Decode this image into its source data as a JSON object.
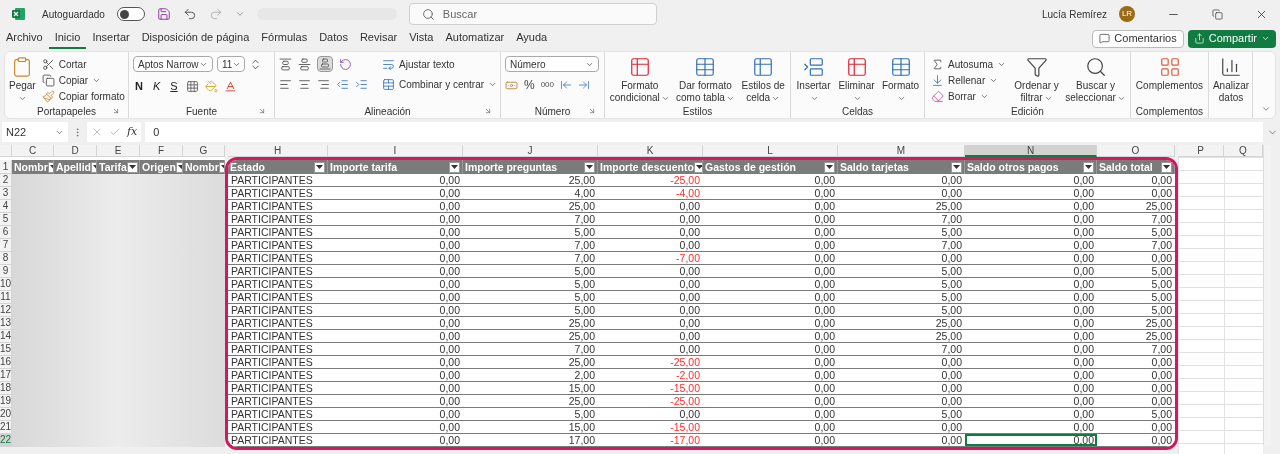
{
  "title_bar": {
    "autosave_label": "Autoguardado",
    "autosave_on": false,
    "search_placeholder": "Buscar",
    "user_name": "Lucía Remírez",
    "user_initials": "LR"
  },
  "menu_tabs": [
    {
      "label": "Archivo",
      "selected": false
    },
    {
      "label": "Inicio",
      "selected": true
    },
    {
      "label": "Insertar",
      "selected": false
    },
    {
      "label": "Disposición de página",
      "selected": false
    },
    {
      "label": "Fórmulas",
      "selected": false
    },
    {
      "label": "Datos",
      "selected": false
    },
    {
      "label": "Revisar",
      "selected": false
    },
    {
      "label": "Vista",
      "selected": false
    },
    {
      "label": "Automatizar",
      "selected": false
    },
    {
      "label": "Ayuda",
      "selected": false
    }
  ],
  "actions": {
    "comments": "Comentarios",
    "share": "Compartir"
  },
  "ribbon": {
    "clipboard": {
      "title": "Portapapeles",
      "paste": "Pegar",
      "cut": "Cortar",
      "copy": "Copiar",
      "format_painter": "Copiar formato"
    },
    "font": {
      "title": "Fuente",
      "font_name": "Aptos Narrow",
      "font_size": "11",
      "bold": "N",
      "italic": "K",
      "underline": "S"
    },
    "alignment": {
      "title": "Alineación",
      "bottom_selected": true,
      "wrap_text": "Ajustar texto",
      "merge_center": "Combinar y centrar"
    },
    "number": {
      "title": "Número",
      "format": "Número",
      "percent": "%",
      "thousands": "000"
    },
    "styles": {
      "title": "Estilos",
      "conditional": "Formato condicional",
      "as_table": "Dar formato como tabla",
      "cell_styles": "Estilos de celda"
    },
    "cells": {
      "title": "Celdas",
      "insert": "Insertar",
      "delete": "Eliminar",
      "format": "Formato"
    },
    "editing": {
      "title": "Edición",
      "autosum": "Autosuma",
      "fill": "Rellenar",
      "clear": "Borrar",
      "sort_filter": "Ordenar y filtrar",
      "find_select": "Buscar y seleccionar"
    },
    "addins": {
      "title": "Complementos",
      "addins": "Complementos"
    },
    "analyze": {
      "analyze": "Analizar datos"
    }
  },
  "formula_bar": {
    "name_box": "N22",
    "function_label": "fx",
    "formula": "0"
  },
  "sheet": {
    "columns": [
      {
        "label": "C",
        "selected": false
      },
      {
        "label": "D",
        "selected": false
      },
      {
        "label": "E",
        "selected": false
      },
      {
        "label": "F",
        "selected": false
      },
      {
        "label": "G",
        "selected": false
      },
      {
        "label": "H",
        "selected": false
      },
      {
        "label": "I",
        "selected": false
      },
      {
        "label": "J",
        "selected": false
      },
      {
        "label": "K",
        "selected": false
      },
      {
        "label": "L",
        "selected": false
      },
      {
        "label": "M",
        "selected": false
      },
      {
        "label": "N",
        "selected": true
      },
      {
        "label": "O",
        "selected": false
      },
      {
        "label": "P",
        "selected": false
      },
      {
        "label": "Q",
        "selected": false
      }
    ],
    "blurred_headers": [
      "Nombr",
      "Apellid",
      "Tarifa",
      "Origen",
      "Nombr"
    ]
  },
  "table": {
    "header_row": "1",
    "headers": [
      "Estado",
      "Importe tarifa",
      "Importe preguntas",
      "Importe descuento",
      "Gastos de gestión",
      "Saldo tarjetas",
      "Saldo otros pagos",
      "Saldo total"
    ],
    "rows": [
      {
        "number": "2",
        "selected": false,
        "negative": true,
        "cells": [
          "PARTICIPANTES",
          "0,00",
          "25,00",
          "-25,00",
          "0,00",
          "0,00",
          "0,00",
          "0,00"
        ]
      },
      {
        "number": "3",
        "selected": false,
        "negative": true,
        "cells": [
          "PARTICIPANTES",
          "0,00",
          "4,00",
          "-4,00",
          "0,00",
          "0,00",
          "0,00",
          "0,00"
        ]
      },
      {
        "number": "4",
        "selected": false,
        "negative": false,
        "cells": [
          "PARTICIPANTES",
          "0,00",
          "25,00",
          "0,00",
          "0,00",
          "25,00",
          "0,00",
          "25,00"
        ]
      },
      {
        "number": "5",
        "selected": false,
        "negative": false,
        "cells": [
          "PARTICIPANTES",
          "0,00",
          "7,00",
          "0,00",
          "0,00",
          "7,00",
          "0,00",
          "7,00"
        ]
      },
      {
        "number": "6",
        "selected": false,
        "negative": false,
        "cells": [
          "PARTICIPANTES",
          "0,00",
          "5,00",
          "0,00",
          "0,00",
          "5,00",
          "0,00",
          "5,00"
        ]
      },
      {
        "number": "7",
        "selected": false,
        "negative": false,
        "cells": [
          "PARTICIPANTES",
          "0,00",
          "7,00",
          "0,00",
          "0,00",
          "7,00",
          "0,00",
          "7,00"
        ]
      },
      {
        "number": "8",
        "selected": false,
        "negative": true,
        "cells": [
          "PARTICIPANTES",
          "0,00",
          "7,00",
          "-7,00",
          "0,00",
          "0,00",
          "0,00",
          "0,00"
        ]
      },
      {
        "number": "9",
        "selected": false,
        "negative": false,
        "cells": [
          "PARTICIPANTES",
          "0,00",
          "5,00",
          "0,00",
          "0,00",
          "5,00",
          "0,00",
          "5,00"
        ]
      },
      {
        "number": "10",
        "selected": false,
        "negative": false,
        "cells": [
          "PARTICIPANTES",
          "0,00",
          "5,00",
          "0,00",
          "0,00",
          "5,00",
          "0,00",
          "5,00"
        ]
      },
      {
        "number": "11",
        "selected": false,
        "negative": false,
        "cells": [
          "PARTICIPANTES",
          "0,00",
          "5,00",
          "0,00",
          "0,00",
          "5,00",
          "0,00",
          "5,00"
        ]
      },
      {
        "number": "12",
        "selected": false,
        "negative": false,
        "cells": [
          "PARTICIPANTES",
          "0,00",
          "5,00",
          "0,00",
          "0,00",
          "5,00",
          "0,00",
          "5,00"
        ]
      },
      {
        "number": "13",
        "selected": false,
        "negative": false,
        "cells": [
          "PARTICIPANTES",
          "0,00",
          "25,00",
          "0,00",
          "0,00",
          "25,00",
          "0,00",
          "25,00"
        ]
      },
      {
        "number": "14",
        "selected": false,
        "negative": false,
        "cells": [
          "PARTICIPANTES",
          "0,00",
          "25,00",
          "0,00",
          "0,00",
          "25,00",
          "0,00",
          "25,00"
        ]
      },
      {
        "number": "15",
        "selected": false,
        "negative": false,
        "cells": [
          "PARTICIPANTES",
          "0,00",
          "7,00",
          "0,00",
          "0,00",
          "7,00",
          "0,00",
          "7,00"
        ]
      },
      {
        "number": "16",
        "selected": false,
        "negative": true,
        "cells": [
          "PARTICIPANTES",
          "0,00",
          "25,00",
          "-25,00",
          "0,00",
          "0,00",
          "0,00",
          "0,00"
        ]
      },
      {
        "number": "17",
        "selected": false,
        "negative": true,
        "cells": [
          "PARTICIPANTES",
          "0,00",
          "2,00",
          "-2,00",
          "0,00",
          "0,00",
          "0,00",
          "0,00"
        ]
      },
      {
        "number": "18",
        "selected": false,
        "negative": true,
        "cells": [
          "PARTICIPANTES",
          "0,00",
          "15,00",
          "-15,00",
          "0,00",
          "0,00",
          "0,00",
          "0,00"
        ]
      },
      {
        "number": "19",
        "selected": false,
        "negative": true,
        "cells": [
          "PARTICIPANTES",
          "0,00",
          "25,00",
          "-25,00",
          "0,00",
          "0,00",
          "0,00",
          "0,00"
        ]
      },
      {
        "number": "20",
        "selected": false,
        "negative": false,
        "cells": [
          "PARTICIPANTES",
          "0,00",
          "5,00",
          "0,00",
          "0,00",
          "5,00",
          "0,00",
          "5,00"
        ]
      },
      {
        "number": "21",
        "selected": false,
        "negative": true,
        "cells": [
          "PARTICIPANTES",
          "0,00",
          "15,00",
          "-15,00",
          "0,00",
          "0,00",
          "0,00",
          "0,00"
        ]
      },
      {
        "number": "22",
        "selected": true,
        "negative": true,
        "cells": [
          "PARTICIPANTES",
          "0,00",
          "17,00",
          "-17,00",
          "0,00",
          "0,00",
          "0,00",
          "0,00"
        ]
      }
    ]
  }
}
